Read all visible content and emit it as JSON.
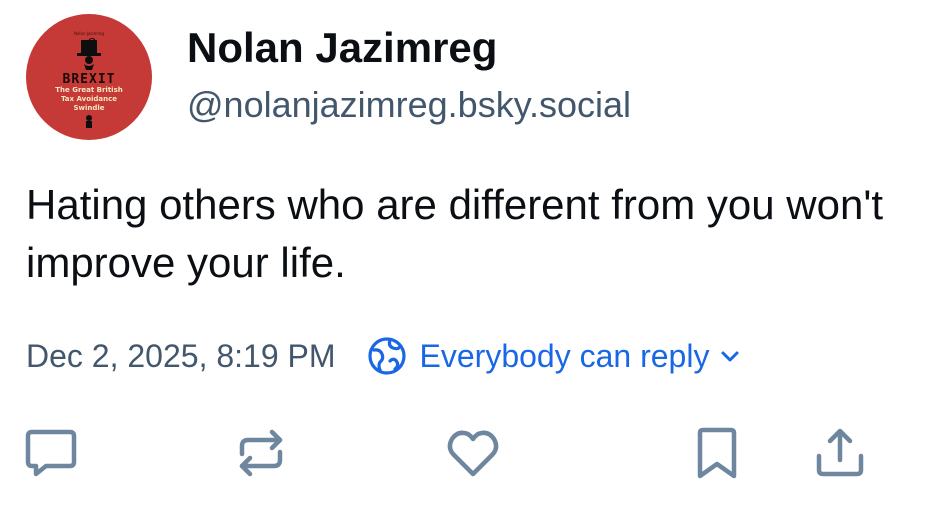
{
  "author": {
    "display_name": "Nolan Jazimreg",
    "handle": "@nolanjazimreg.bsky.social",
    "avatar": {
      "top_line1": "Nolan Jazimreg",
      "title": "BREXIT",
      "subtitle_line1": "The Great British",
      "subtitle_line2": "Tax Avoidance",
      "subtitle_line3": "Swindle"
    }
  },
  "post": {
    "text": "Hating others who are different from you won't improve your life."
  },
  "meta": {
    "timestamp": "Dec 2, 2025, 8:19 PM",
    "reply_setting": "Everybody can reply"
  },
  "actions": [
    {
      "name": "reply",
      "icon": "speech-bubble-icon"
    },
    {
      "name": "repost",
      "icon": "repost-arrows-icon"
    },
    {
      "name": "like",
      "icon": "heart-icon"
    },
    {
      "name": "bookmark",
      "icon": "bookmark-icon"
    },
    {
      "name": "share",
      "icon": "share-upload-icon"
    }
  ],
  "colors": {
    "text": "#0b0f14",
    "muted": "#42576c",
    "accent": "#1a67e6",
    "icon": "#6f869f",
    "avatar_bg": "#c53a36"
  }
}
